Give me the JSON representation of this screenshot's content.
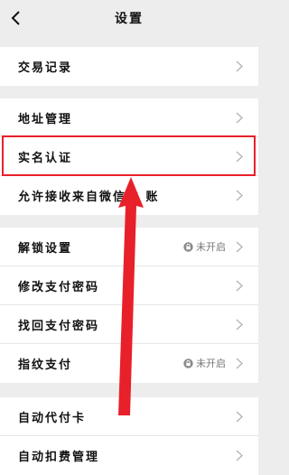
{
  "header": {
    "title": "设置",
    "back_icon": "back-chevron-icon"
  },
  "groups": [
    {
      "items": [
        {
          "label": "交易记录"
        }
      ]
    },
    {
      "items": [
        {
          "label": "地址管理"
        },
        {
          "label": "实名认证"
        },
        {
          "label": "允许接收来自微信的 账"
        }
      ]
    },
    {
      "items": [
        {
          "label": "解锁设置",
          "status": "未开启"
        },
        {
          "label": "修改支付密码"
        },
        {
          "label": "找回支付密码"
        },
        {
          "label": "指纹支付",
          "status": "未开启"
        }
      ]
    },
    {
      "items": [
        {
          "label": "自动代付卡"
        },
        {
          "label": "自动扣费管理"
        }
      ]
    }
  ],
  "colors": {
    "highlight": "#e8202a",
    "arrow": "#e8202a",
    "background": "#ededed"
  }
}
